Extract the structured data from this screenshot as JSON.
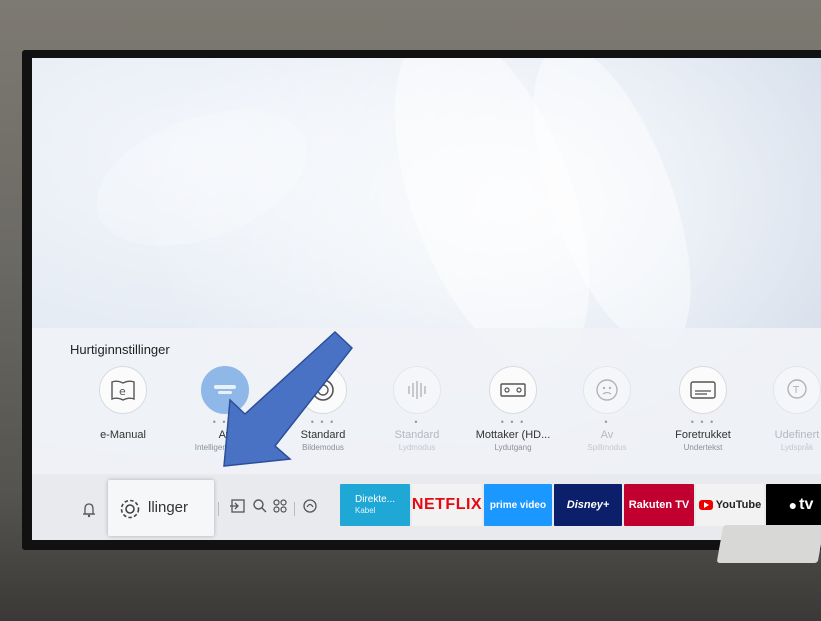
{
  "quick_settings": {
    "title": "Hurtiginnstillinger",
    "items": [
      {
        "label": "e-Manual",
        "sub": "",
        "icon": "book-icon",
        "dim": false
      },
      {
        "label": "Av",
        "sub": "Intelligent modus",
        "icon": "intelligent-mode-icon",
        "dim": false
      },
      {
        "label": "Standard",
        "sub": "Bildemodus",
        "icon": "picture-mode-icon",
        "dim": false
      },
      {
        "label": "Standard",
        "sub": "Lydmodus",
        "icon": "sound-mode-icon",
        "dim": true
      },
      {
        "label": "Mottaker (HD...",
        "sub": "Lydutgang",
        "icon": "receiver-icon",
        "dim": false
      },
      {
        "label": "Av",
        "sub": "Spillmodus",
        "icon": "game-mode-icon",
        "dim": true
      },
      {
        "label": "Foretrukket",
        "sub": "Undertekst",
        "icon": "subtitle-icon",
        "dim": false
      },
      {
        "label": "Udefinert",
        "sub": "Lydspråk",
        "icon": "audio-language-icon",
        "dim": true
      }
    ]
  },
  "bar": {
    "settings_label": "llinger",
    "apps": [
      {
        "name": "Direkte...",
        "sub": "Kabel",
        "bg": "#1fa7d6",
        "color": "#ffffff"
      },
      {
        "name": "NETFLIX",
        "bg": "#f2f2f2",
        "color": "#e50914"
      },
      {
        "name": "prime video",
        "bg": "#1a98ff",
        "color": "#ffffff"
      },
      {
        "name": "Disney+",
        "bg": "#0b1f6b",
        "color": "#ffffff"
      },
      {
        "name": "Rakuten TV",
        "bg": "#c2002f",
        "color": "#ffffff"
      },
      {
        "name": "YouTube",
        "bg": "#f2f2f2",
        "color": "#222222"
      },
      {
        "name": "tv",
        "bg": "#000000",
        "color": "#ffffff"
      }
    ]
  },
  "colors": {
    "arrow": "#4a72c4",
    "arrow_stroke": "#2b4f99"
  }
}
